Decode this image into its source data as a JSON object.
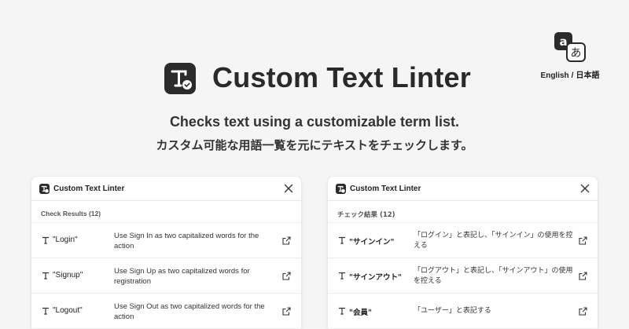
{
  "header": {
    "title": "Custom Text Linter",
    "subtitle_en": "Checks text using a customizable term list.",
    "subtitle_ja": "カスタム可能な用語一覧を元にテキストをチェックします。"
  },
  "lang": {
    "english": "English",
    "separator": "/",
    "japanese": "日本語",
    "icon_latin": "a",
    "icon_kana": "あ"
  },
  "panel_en": {
    "title": "Custom Text Linter",
    "section": "Check Results (12)",
    "rows": [
      {
        "term": "\"Login\"",
        "message": "Use Sign In as two capitalized words for the action"
      },
      {
        "term": "\"Signup\"",
        "message": "Use Sign Up as two capitalized words for registration"
      },
      {
        "term": "\"Logout\"",
        "message": "Use Sign Out as two capitalized words for the action"
      }
    ]
  },
  "panel_ja": {
    "title": "Custom Text Linter",
    "section": "チェック結果 (12)",
    "rows": [
      {
        "term": "\"サインイン\"",
        "message": "「ログイン」と表記し、「サインイン」の使用を控える"
      },
      {
        "term": "\"サインアウト\"",
        "message": "「ログアウト」と表記し、「サインアウト」の使用を控える"
      },
      {
        "term": "\"会員\"",
        "message": "「ユーザー」と表記する"
      }
    ]
  },
  "colors": {
    "background": "#f5f5f5",
    "logo_dark": "#2b2b2b",
    "panel": "#ffffff"
  },
  "icons": {
    "app_logo": "text-check-icon",
    "close": "close-icon",
    "external": "external-link-icon",
    "term": "text-t-icon",
    "language": "translate-icon"
  }
}
